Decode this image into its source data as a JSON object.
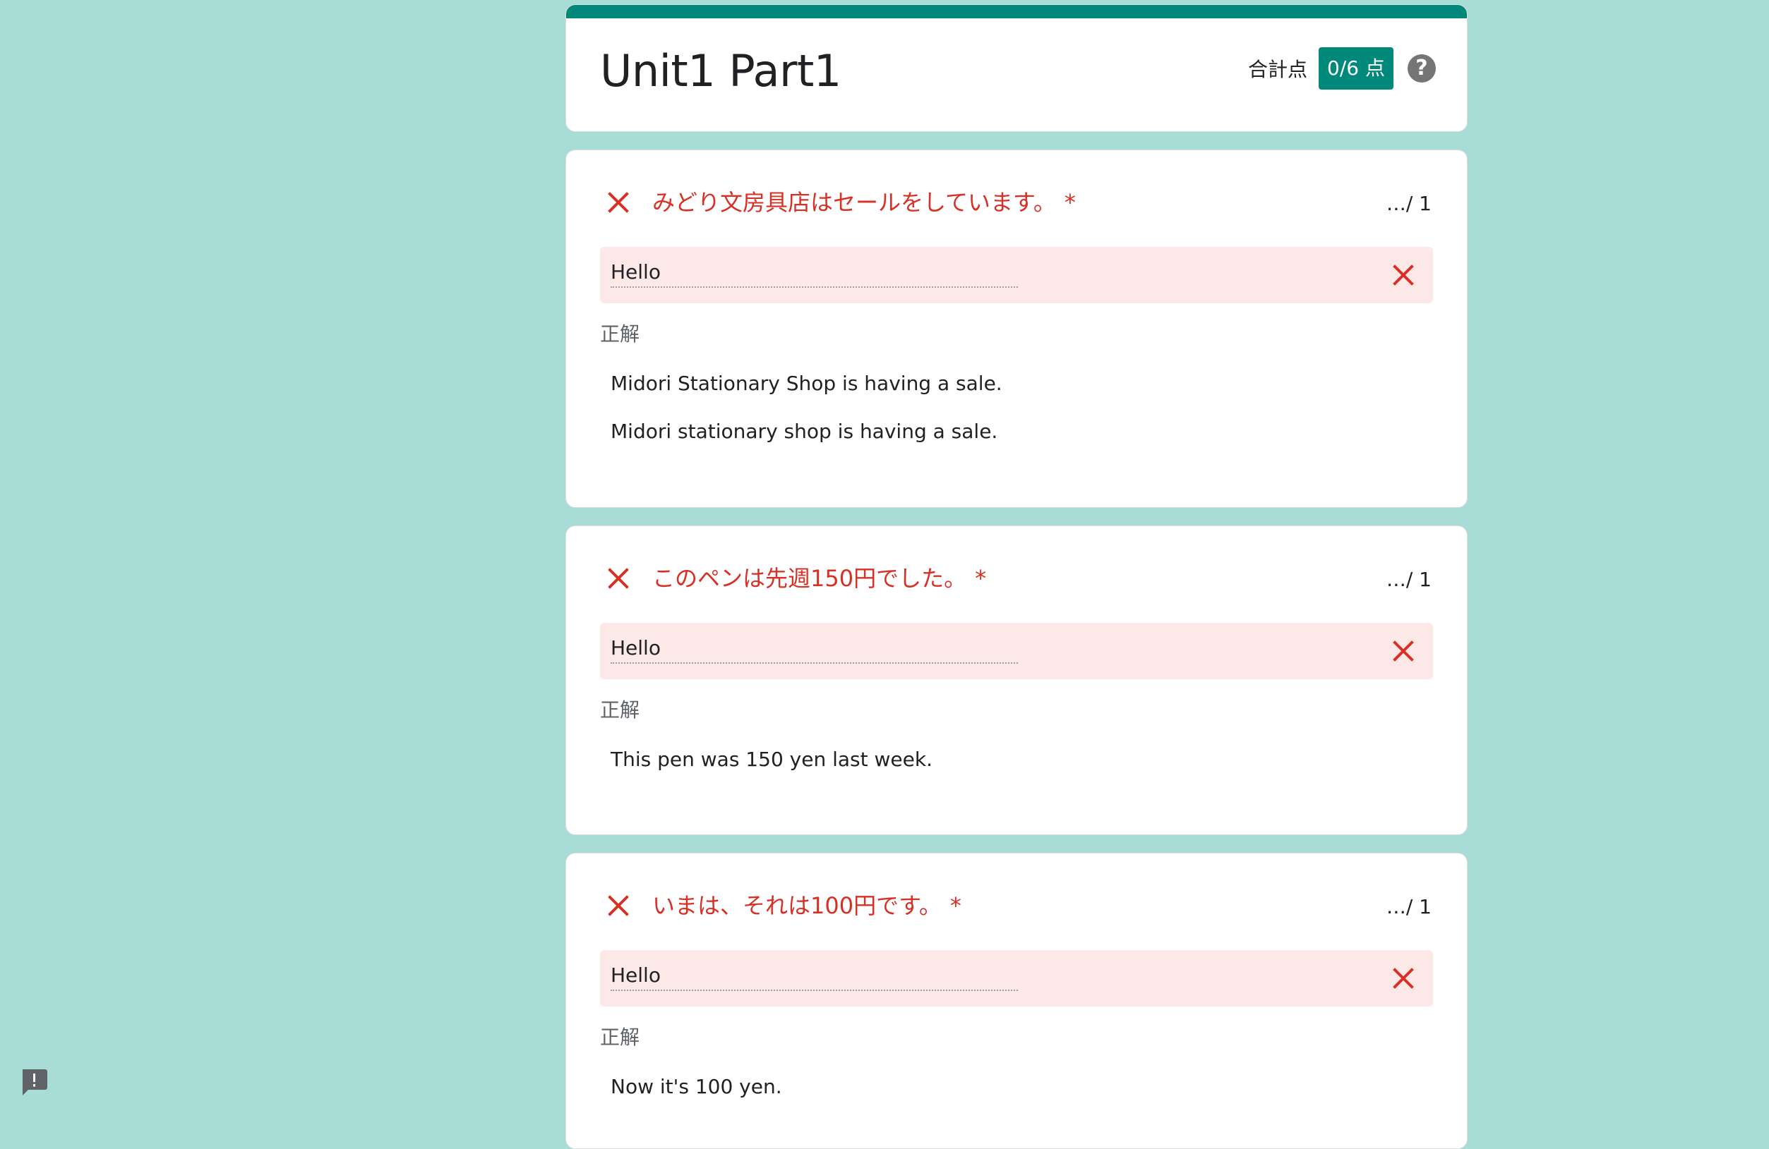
{
  "form": {
    "title": "Unit1 Part1",
    "score_label": "合計点",
    "score_value": "0/6 点",
    "help_icon": "?"
  },
  "questions": [
    {
      "title": "みどり文房具店はセールをしています。",
      "required_marker": "*",
      "points": "…/ 1",
      "answer": "Hello",
      "correct_label": "正解",
      "correct_answers": [
        "Midori Stationary Shop is having a sale.",
        "Midori stationary shop is having a sale."
      ]
    },
    {
      "title": "このペンは先週150円でした。",
      "required_marker": "*",
      "points": "…/ 1",
      "answer": "Hello",
      "correct_label": "正解",
      "correct_answers": [
        "This pen was 150 yen last week."
      ]
    },
    {
      "title": "いまは、それは100円です。",
      "required_marker": "*",
      "points": "…/ 1",
      "answer": "Hello",
      "correct_label": "正解",
      "correct_answers": [
        "Now it's 100 yen."
      ]
    }
  ],
  "icons": {
    "incorrect": "close-icon",
    "help": "help-icon",
    "feedback": "feedback-icon"
  },
  "colors": {
    "background": "#a8dcd6",
    "accent": "#00897b",
    "error": "#d93025",
    "answer_bg": "#fce8e6"
  }
}
